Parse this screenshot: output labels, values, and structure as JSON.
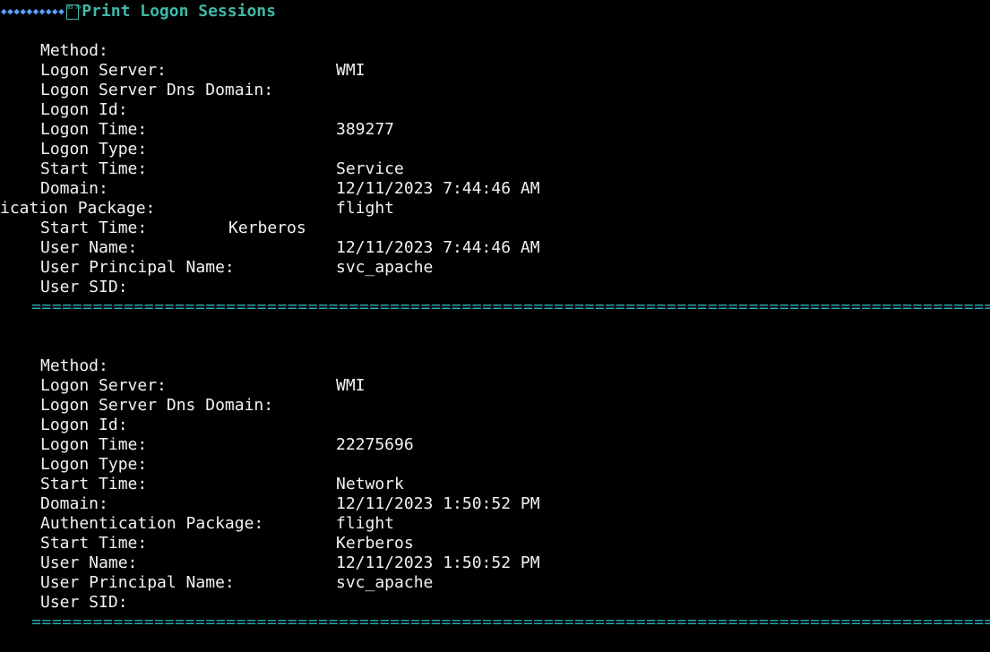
{
  "header": {
    "icon": "replacement-char-diamonds",
    "code_glyph": "03 79",
    "title": "Print Logon Sessions"
  },
  "sessions": [
    {
      "method_label": "Method:",
      "method_value": "WMI",
      "logon_server_label": "Logon Server:",
      "logon_server_value": "",
      "dns_domain_label": "Logon Server Dns Domain:",
      "dns_domain_value": "",
      "logon_id_label": "Logon Id:",
      "logon_id_value": "389277",
      "logon_time_label": "Logon Time:",
      "logon_time_value": "",
      "logon_type_label": "Logon Type:",
      "logon_type_value": "Service",
      "start_time_label": "Start Time:",
      "start_time_value": "12/11/2023 7:44:46 AM",
      "domain_label": "Domain:",
      "domain_value": "flight",
      "auth_package_label": "ication Package:",
      "auth_package_value": "Kerberos",
      "start_time2_label": "Start Time:",
      "start_time2_value": "12/11/2023 7:44:46 AM",
      "user_name_label": "User Name:",
      "user_name_value": "svc_apache",
      "upn_label": "User Principal Name:",
      "upn_value": "",
      "sid_label": "User SID:",
      "sid_value": ""
    },
    {
      "method_label": "Method:",
      "method_value": "WMI",
      "logon_server_label": "Logon Server:",
      "logon_server_value": "",
      "dns_domain_label": "Logon Server Dns Domain:",
      "dns_domain_value": "",
      "logon_id_label": "Logon Id:",
      "logon_id_value": "22275696",
      "logon_time_label": "Logon Time:",
      "logon_time_value": "",
      "logon_type_label": "Logon Type:",
      "logon_type_value": "Network",
      "start_time_label": "Start Time:",
      "start_time_value": "12/11/2023 1:50:52 PM",
      "domain_label": "Domain:",
      "domain_value": "flight",
      "auth_package_label": "Authentication Package:",
      "auth_package_value": "Kerberos",
      "start_time2_label": "Start Time:",
      "start_time2_value": "12/11/2023 1:50:52 PM",
      "user_name_label": "User Name:",
      "user_name_value": "svc_apache",
      "upn_label": "User Principal Name:",
      "upn_value": "",
      "sid_label": "User SID:",
      "sid_value": ""
    }
  ],
  "separator": "===================================================================================================================",
  "colors": {
    "background": "#000000",
    "text": "#f2f2f2",
    "header": "#3fb8a8",
    "separator": "#2aa7b3",
    "diamonds": "#5aa0ff"
  }
}
